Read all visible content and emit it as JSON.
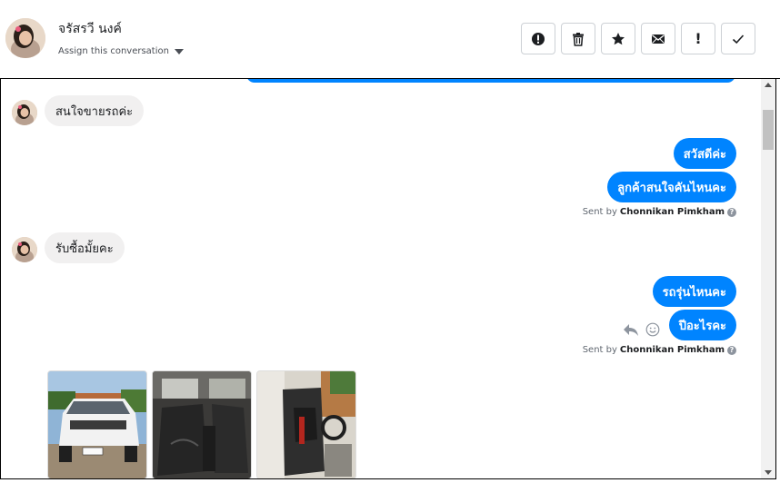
{
  "header": {
    "contact_name": "จรัสรวี นงค์",
    "assign_label": "Assign this conversation"
  },
  "actions": [
    {
      "name": "spam-button",
      "icon": "alert-circle-icon"
    },
    {
      "name": "delete-button",
      "icon": "trash-icon"
    },
    {
      "name": "star-button",
      "icon": "star-icon"
    },
    {
      "name": "mark-unread-button",
      "icon": "envelope-icon"
    },
    {
      "name": "important-button",
      "icon": "exclamation-icon",
      "glyph": "!"
    },
    {
      "name": "done-button",
      "icon": "checkmark-icon"
    }
  ],
  "messages": {
    "in_1": "สนใจขายรถค่ะ",
    "out_1": "สวัสดีค่ะ",
    "out_2": "ลูกค้าสนใจคันไหนคะ",
    "in_2": "รับซื้อมั้ยคะ",
    "out_3": "รถรุ่นไหนคะ",
    "out_4": "ปีอะไรคะ"
  },
  "sent_by": {
    "prefix": "Sent by",
    "agent": "Chonnikan Pimkham",
    "help": "?"
  },
  "colors": {
    "outgoing_bubble": "#0084ff",
    "incoming_bubble": "#f1f0f0"
  }
}
